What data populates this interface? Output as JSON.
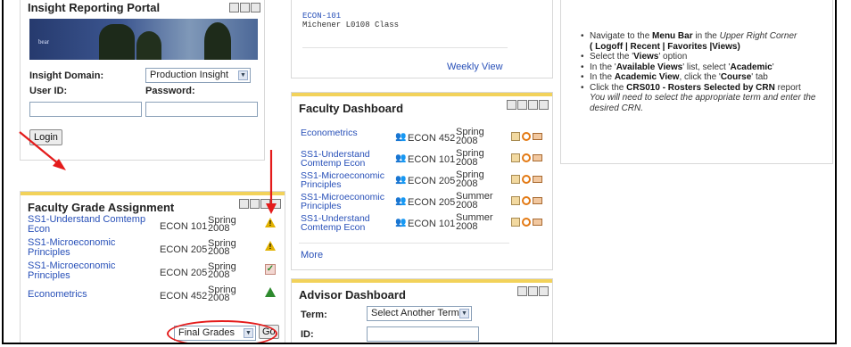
{
  "portal": {
    "title": "Insight Reporting Portal",
    "banner_logo": "bear",
    "insight_domain_label": "Insight Domain:",
    "insight_domain_value": "Production Insight",
    "user_id_label": "User ID:",
    "password_label": "Password:",
    "login_label": "Login"
  },
  "fga": {
    "title": "Faculty Grade Assignment",
    "rows": [
      {
        "course_title": "SS1-Understand Comtemp Econ",
        "course": "ECON 101",
        "term": "Spring",
        "year": "2008",
        "status": "warning-icon"
      },
      {
        "course_title": "SS1-Microeconomic Principles",
        "course": "ECON 205",
        "term": "Spring",
        "year": "2008",
        "status": "warning-icon"
      },
      {
        "course_title": "SS1-Microeconomic Principles",
        "course": "ECON 205",
        "term": "Spring",
        "year": "2008",
        "status": "checked-icon"
      },
      {
        "course_title": "Econometrics",
        "course": "ECON 452",
        "term": "Spring",
        "year": "2008",
        "status": "green-triangle-icon"
      }
    ],
    "select_value": "Final Grades",
    "go_label": "Go"
  },
  "schedule": {
    "course": "ECON-101",
    "location": "Michener L0108 Class",
    "weekly_view": "Weekly View"
  },
  "faculty_dashboard": {
    "title": "Faculty Dashboard",
    "rows": [
      {
        "course_title": "Econometrics",
        "course": "ECON 452",
        "term": "Spring",
        "year": "2008"
      },
      {
        "course_title": "SS1-Understand Comtemp Econ",
        "course": "ECON 101",
        "term": "Spring",
        "year": "2008"
      },
      {
        "course_title": "SS1-Microeconomic Principles",
        "course": "ECON 205",
        "term": "Spring",
        "year": "2008"
      },
      {
        "course_title": "SS1-Microeconomic Principles",
        "course": "ECON 205",
        "term": "Summer",
        "year": "2008"
      },
      {
        "course_title": "SS1-Understand Comtemp Econ",
        "course": "ECON 101",
        "term": "Summer",
        "year": "2008"
      }
    ],
    "more": "More"
  },
  "advisor_dashboard": {
    "title": "Advisor Dashboard",
    "term_label": "Term:",
    "term_select": "Select Another Term",
    "id_label": "ID:"
  },
  "instructions": {
    "b1_pre": "Navigate to the ",
    "b1_bold": "Menu Bar",
    "b1_mid": " in the ",
    "b1_ital": "Upper Right Corner",
    "b1_paren": "( Logoff | Recent | Favorites |Views)",
    "b2_pre": "Select the '",
    "b2_bold": "Views",
    "b2_post": "' option",
    "b3_pre": "In the '",
    "b3_bold": "Available Views",
    "b3_mid": "' list, select '",
    "b3_bold2": "Academic",
    "b3_post": "'",
    "b4_pre": "In the ",
    "b4_bold": "Academic View",
    "b4_mid": ", click the '",
    "b4_bold2": "Course",
    "b4_post": "' tab",
    "b5_pre": "Click the ",
    "b5_bold": "CRS010 - Rosters Selected by CRN",
    "b5_post": " report",
    "note": "You will need to select the appropriate term and enter the desired CRN."
  },
  "colors": {
    "accent": "#f2d25a",
    "link": "#2850b8",
    "annotation": "#e41b1b"
  }
}
